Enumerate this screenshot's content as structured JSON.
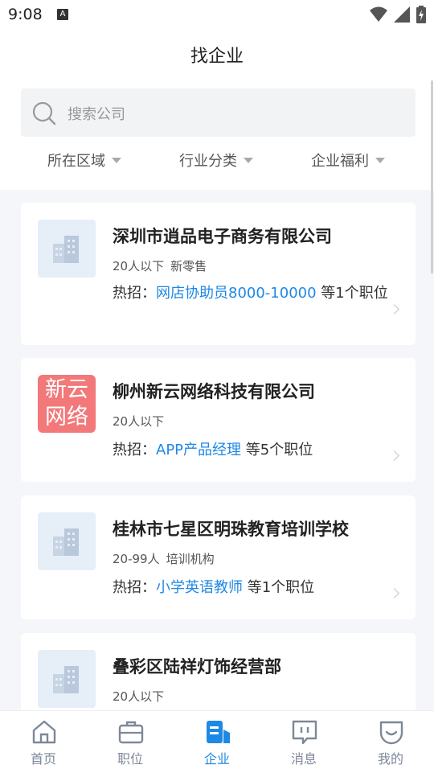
{
  "status_bar": {
    "time": "9:08",
    "notif_icon": "A"
  },
  "header": {
    "title": "找企业"
  },
  "search": {
    "placeholder": "搜索公司"
  },
  "filters": [
    {
      "label": "所在区域"
    },
    {
      "label": "行业分类"
    },
    {
      "label": "企业福利"
    }
  ],
  "companies": [
    {
      "name": "深圳市逍品电子商务有限公司",
      "tags": [
        "20人以下",
        "新零售"
      ],
      "hot_label": "热招：",
      "hot_job": "网店协助员8000-10000",
      "hot_more": " 等1个职位"
    },
    {
      "name": "柳州新云网络科技有限公司",
      "logo_text": [
        "新云",
        "网络"
      ],
      "tags": [
        "20人以下"
      ],
      "hot_label": "热招：",
      "hot_job": "APP产品经理",
      "hot_more": " 等5个职位"
    },
    {
      "name": "桂林市七星区明珠教育培训学校",
      "tags": [
        "20-99人",
        "培训机构"
      ],
      "hot_label": "热招：",
      "hot_job": "小学英语教师",
      "hot_more": " 等1个职位"
    },
    {
      "name": "叠彩区陆祥灯饰经营部",
      "tags": [
        "20人以下"
      ]
    }
  ],
  "tabs": [
    {
      "label": "首页",
      "icon": "home-icon"
    },
    {
      "label": "职位",
      "icon": "briefcase-icon"
    },
    {
      "label": "企业",
      "icon": "company-icon",
      "active": true
    },
    {
      "label": "消息",
      "icon": "message-icon"
    },
    {
      "label": "我的",
      "icon": "profile-icon"
    }
  ],
  "colors": {
    "accent": "#1e88e5",
    "tab_inactive": "#7d8899",
    "logo_red": "#f2787a",
    "page_bg": "#f4f6f9"
  }
}
